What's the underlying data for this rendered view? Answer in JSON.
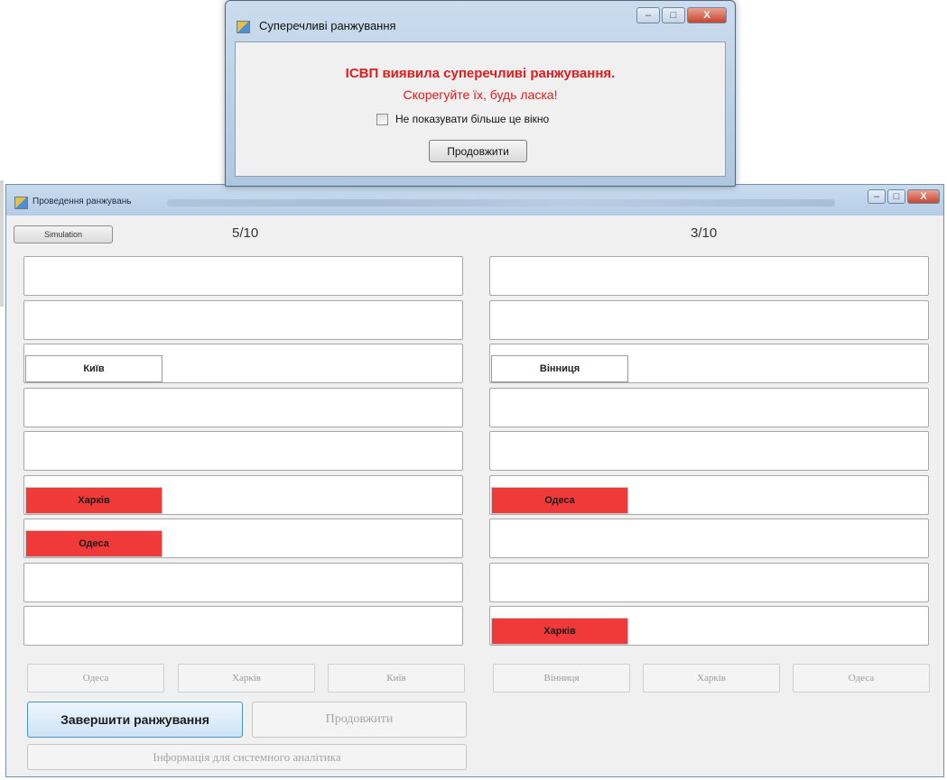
{
  "dialog": {
    "title": "Суперечливі ранжування",
    "message_line1": "ІСВП виявила суперечливі ранжування.",
    "message_line2": "Скорегуйте їх, будь ласка!",
    "checkbox_label": "Не показувати більше це вікно",
    "checkbox_checked": false,
    "continue_button": "Продовжити",
    "close_glyph": "X"
  },
  "window": {
    "title": "Проведення ранжувань",
    "simulation_button": "Simulation",
    "left_counter": "5/10",
    "right_counter": "3/10"
  },
  "left_slots": [
    "",
    "",
    "Київ",
    "",
    "",
    "Харків",
    "Одеса",
    "",
    ""
  ],
  "left_slot_colors": [
    "",
    "",
    "white",
    "",
    "",
    "red",
    "red",
    "",
    ""
  ],
  "right_slots": [
    "",
    "",
    "Вінниця",
    "",
    "",
    "Одеса",
    "",
    "",
    "Харків"
  ],
  "right_slot_colors": [
    "",
    "",
    "white",
    "",
    "",
    "red",
    "",
    "",
    "red"
  ],
  "left_city_buttons": [
    "Одеса",
    "Харків",
    "Київ"
  ],
  "right_city_buttons": [
    "Вінниця",
    "Харків",
    "Одеса"
  ],
  "actions": {
    "finish_button": "Завершити ранжування",
    "continue_button": "Продовжити",
    "info_button": "Інформація для системного аналітика"
  },
  "colors": {
    "conflict_red": "#f03a3a",
    "message_red": "#e31b1b"
  }
}
